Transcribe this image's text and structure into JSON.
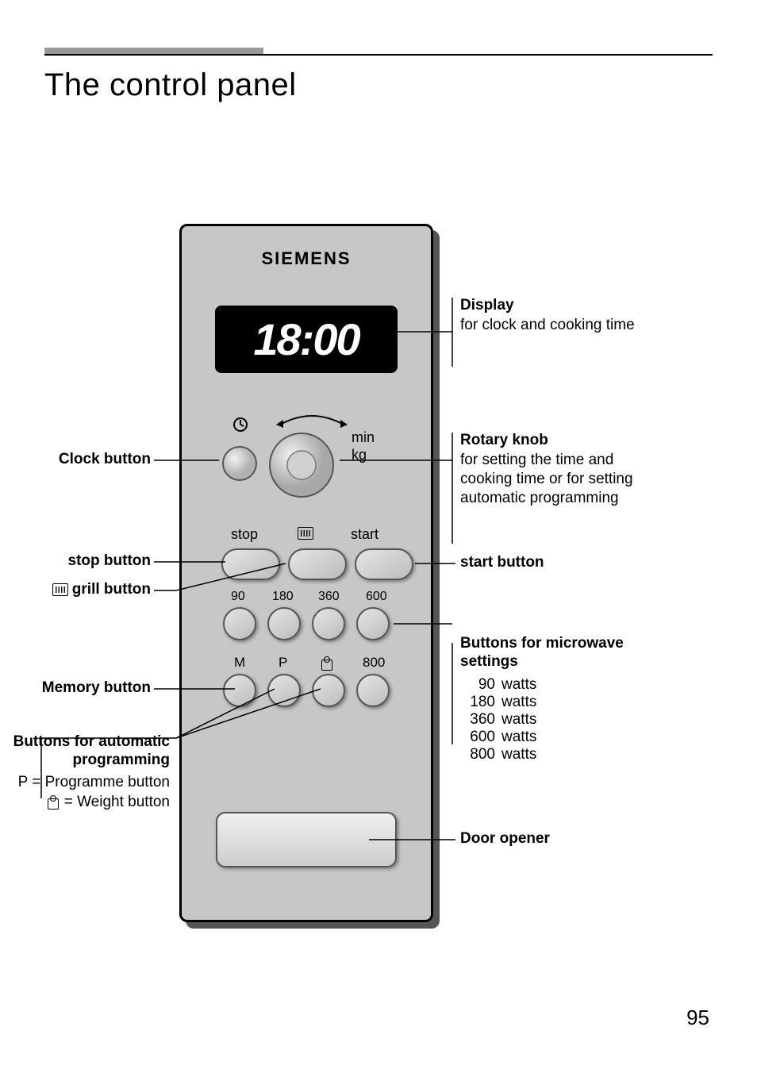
{
  "page": {
    "title": "The control panel",
    "number": "95"
  },
  "panel": {
    "brand": "SIEMENS",
    "display_value": "18:00",
    "knob_units": {
      "min": "min",
      "kg": "kg"
    },
    "row_labels": {
      "stop": "stop",
      "start": "start"
    },
    "power_labels": [
      "90",
      "180",
      "360",
      "600"
    ],
    "bottom_labels": {
      "M": "M",
      "P": "P",
      "eight_hundred": "800"
    }
  },
  "callouts": {
    "display": {
      "title": "Display",
      "desc": "for clock and cooking time"
    },
    "rotary": {
      "title": "Rotary knob",
      "desc": "for setting the time and cooking time or for setting automatic programming"
    },
    "start": {
      "title": "start button"
    },
    "microwave": {
      "title": "Buttons for microwave settings",
      "rows": [
        {
          "n": "90",
          "u": "watts"
        },
        {
          "n": "180",
          "u": "watts"
        },
        {
          "n": "360",
          "u": "watts"
        },
        {
          "n": "600",
          "u": "watts"
        },
        {
          "n": "800",
          "u": "watts"
        }
      ]
    },
    "door": {
      "title": "Door opener"
    },
    "clock": {
      "title": "Clock button"
    },
    "stop": {
      "title": "stop button"
    },
    "grill": {
      "title": "grill button"
    },
    "memory": {
      "title": "Memory button"
    },
    "auto": {
      "title": "Buttons for automatic programming",
      "p_line_prefix": "P",
      "p_line_text": " = Programme button",
      "w_line_text": " = Weight button"
    }
  }
}
